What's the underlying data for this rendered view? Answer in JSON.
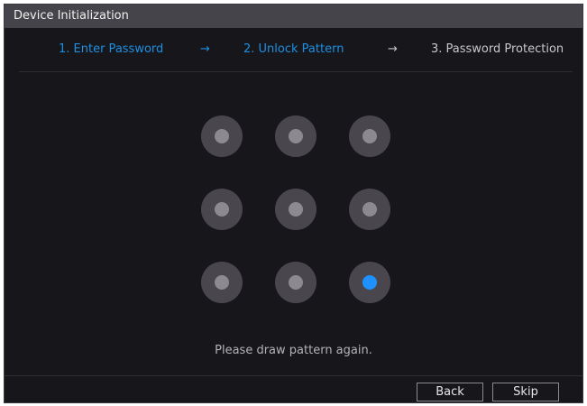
{
  "window": {
    "title": "Device Initialization"
  },
  "steps": [
    {
      "label": "1.  Enter Password",
      "state": "done"
    },
    {
      "label": "2.  Unlock Pattern",
      "state": "active"
    },
    {
      "label": "3.  Password Protection",
      "state": "pending"
    }
  ],
  "step_arrow": "→",
  "pattern": {
    "grid": [
      [
        false,
        false,
        false
      ],
      [
        false,
        false,
        false
      ],
      [
        false,
        false,
        true
      ]
    ],
    "hint": "Please draw pattern again."
  },
  "buttons": {
    "back_label": "Back",
    "skip_label": "Skip"
  },
  "colors": {
    "accent": "#1d8fe2",
    "selected_dot": "#1e90ff",
    "background": "#17171b",
    "titlebar": "#44444a"
  }
}
